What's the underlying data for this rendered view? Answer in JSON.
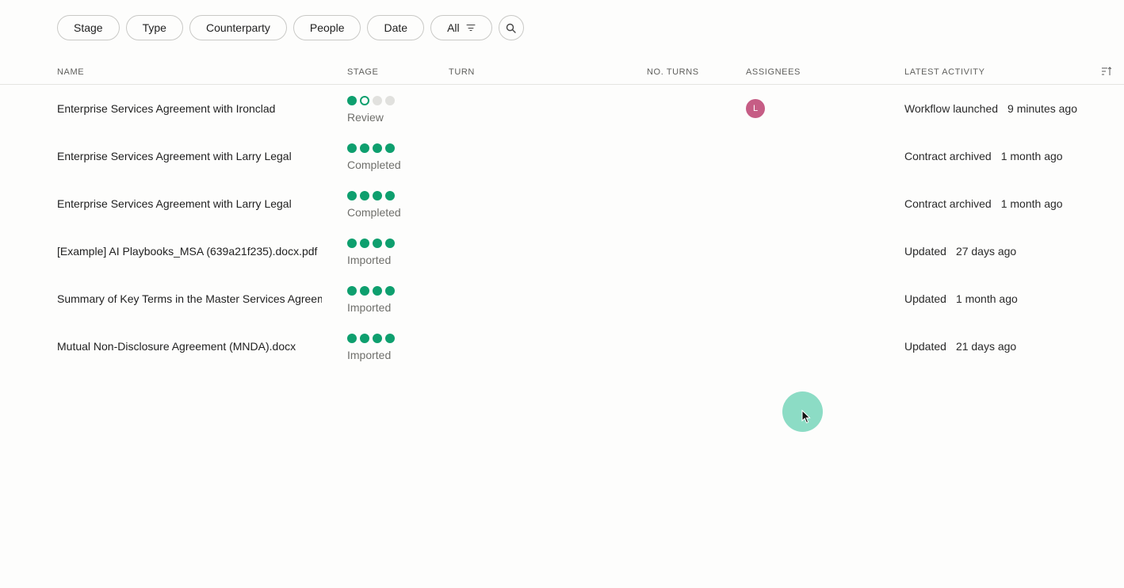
{
  "filters": [
    {
      "label": "Stage"
    },
    {
      "label": "Type"
    },
    {
      "label": "Counterparty"
    },
    {
      "label": "People"
    },
    {
      "label": "Date"
    },
    {
      "label": "All"
    }
  ],
  "columns": {
    "name": "NAME",
    "stage": "STAGE",
    "turn": "TURN",
    "no_turns": "NO. TURNS",
    "assignees": "ASSIGNEES",
    "latest_activity": "LATEST ACTIVITY"
  },
  "rows": [
    {
      "name": "Enterprise Services Agreement with Ironclad",
      "stage_dots": [
        "done",
        "current",
        "todo",
        "todo"
      ],
      "stage": "Review",
      "assignee": "L",
      "activity": "Workflow launched",
      "when": "9 minutes ago"
    },
    {
      "name": "Enterprise Services Agreement with Larry Legal",
      "stage_dots": [
        "done",
        "done",
        "done",
        "done"
      ],
      "stage": "Completed",
      "assignee": "",
      "activity": "Contract archived",
      "when": "1 month ago"
    },
    {
      "name": "Enterprise Services Agreement with Larry Legal",
      "stage_dots": [
        "done",
        "done",
        "done",
        "done"
      ],
      "stage": "Completed",
      "assignee": "",
      "activity": "Contract archived",
      "when": "1 month ago"
    },
    {
      "name": "[Example] AI Playbooks_MSA (639a21f235).docx.pdf",
      "stage_dots": [
        "done",
        "done",
        "done",
        "done"
      ],
      "stage": "Imported",
      "assignee": "",
      "activity": "Updated",
      "when": "27 days ago"
    },
    {
      "name": "Summary of Key Terms in the Master Services Agreement",
      "stage_dots": [
        "done",
        "done",
        "done",
        "done"
      ],
      "stage": "Imported",
      "assignee": "",
      "activity": "Updated",
      "when": "1 month ago"
    },
    {
      "name": "Mutual Non-Disclosure Agreement (MNDA).docx",
      "stage_dots": [
        "done",
        "done",
        "done",
        "done"
      ],
      "stage": "Imported",
      "assignee": "",
      "activity": "Updated",
      "when": "21 days ago"
    }
  ],
  "colors": {
    "stage_complete": "#0e9f6e",
    "stage_pending": "#e1e1de",
    "avatar": "#c65d85",
    "cursor_halo": "#60ceb0"
  },
  "icons": [
    "filter-icon",
    "search-icon",
    "sort-icon",
    "mouse-pointer-icon"
  ]
}
